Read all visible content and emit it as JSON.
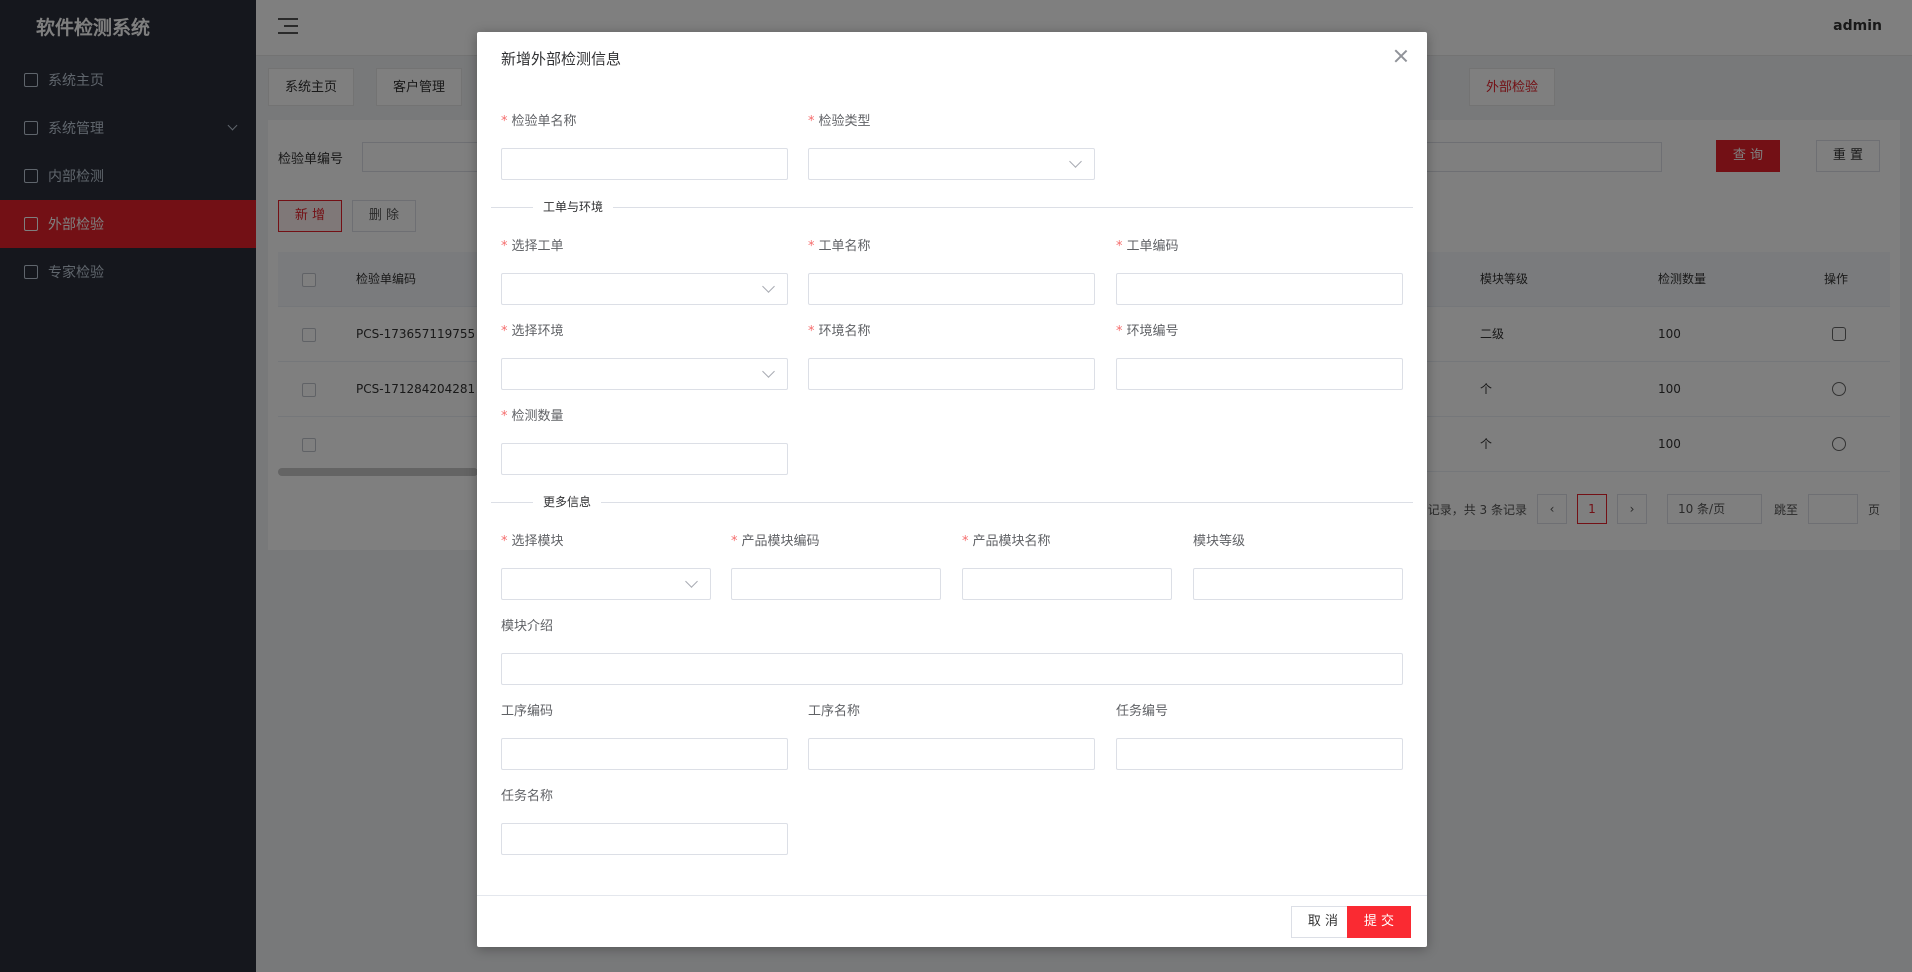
{
  "app": {
    "title": "软件检测系统",
    "user": "admin"
  },
  "sidebar": {
    "items": [
      {
        "label": "系统主页"
      },
      {
        "label": "系统管理"
      },
      {
        "label": "内部检测"
      },
      {
        "label": "外部检验"
      },
      {
        "label": "专家检验"
      }
    ]
  },
  "tags": [
    "系统主页",
    "客户管理",
    "外部检验"
  ],
  "search": {
    "label": "检验单编号",
    "query": "查 询",
    "reset": "重 置"
  },
  "actions": {
    "add": "新 增",
    "delete": "删 除"
  },
  "table": {
    "headers": [
      "检验单编码",
      "模块等级",
      "检测数量",
      "操作"
    ],
    "rows": [
      {
        "code": "PCS-173657119755",
        "level": "二级",
        "qty": "100"
      },
      {
        "code": "PCS-171284204281",
        "level": "个",
        "qty": "100"
      },
      {
        "code": "",
        "level": "个",
        "qty": "100"
      }
    ]
  },
  "pager": {
    "summary": "记录，共 3 条记录",
    "page": "1",
    "size": "10 条/页",
    "jump": "跳至",
    "unit": "页"
  },
  "modal": {
    "title": "新增外部检测信息",
    "fields": {
      "name": "检验单名称",
      "type": "检验类型",
      "order": "选择工单",
      "orderName": "工单名称",
      "orderCode": "工单编码",
      "env": "选择环境",
      "envName": "环境名称",
      "envCode": "环境编号",
      "qty": "检测数量",
      "module": "选择模块",
      "moduleCode": "产品模块编码",
      "moduleName": "产品模块名称",
      "moduleLevel": "模块等级",
      "moduleIntro": "模块介绍",
      "procCode": "工序编码",
      "procName": "工序名称",
      "taskCode": "任务编号",
      "taskName": "任务名称"
    },
    "sections": {
      "orderEnv": "工单与环境",
      "more": "更多信息"
    },
    "footer": {
      "cancel": "取 消",
      "submit": "提 交"
    }
  }
}
